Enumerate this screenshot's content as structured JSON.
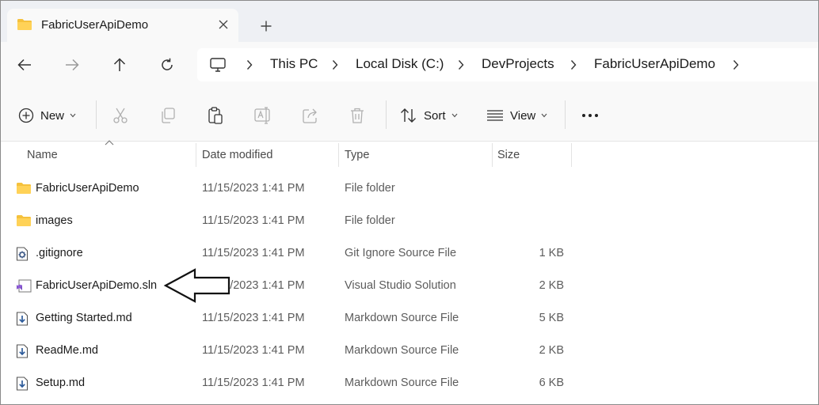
{
  "window": {
    "tab_title": "FabricUserApiDemo",
    "tab_icon": "folder-icon",
    "folder_color": "#f5c13c"
  },
  "breadcrumb": [
    "This PC",
    "Local Disk (C:)",
    "DevProjects",
    "FabricUserApiDemo"
  ],
  "toolbar": {
    "new_label": "New",
    "sort_label": "Sort",
    "view_label": "View",
    "icons": [
      "new-icon",
      "cut-icon",
      "copy-icon",
      "paste-icon",
      "rename-icon",
      "share-icon",
      "delete-icon",
      "sort-icon",
      "view-icon",
      "more-icon"
    ]
  },
  "columns": {
    "name": "Name",
    "date": "Date modified",
    "type": "Type",
    "size": "Size"
  },
  "files": [
    {
      "name": "FabricUserApiDemo",
      "date": "11/15/2023 1:41 PM",
      "type": "File folder",
      "size": "",
      "icon": "folder-icon"
    },
    {
      "name": "images",
      "date": "11/15/2023 1:41 PM",
      "type": "File folder",
      "size": "",
      "icon": "folder-icon"
    },
    {
      "name": ".gitignore",
      "date": "11/15/2023 1:41 PM",
      "type": "Git Ignore Source File",
      "size": "1 KB",
      "icon": "gear-file-icon"
    },
    {
      "name": "FabricUserApiDemo.sln",
      "date": "11/15/2023 1:41 PM",
      "type": "Visual Studio Solution",
      "size": "2 KB",
      "icon": "visual-studio-icon"
    },
    {
      "name": "Getting Started.md",
      "date": "11/15/2023 1:41 PM",
      "type": "Markdown Source File",
      "size": "5 KB",
      "icon": "markdown-file-icon"
    },
    {
      "name": "ReadMe.md",
      "date": "11/15/2023 1:41 PM",
      "type": "Markdown Source File",
      "size": "2 KB",
      "icon": "markdown-file-icon"
    },
    {
      "name": "Setup.md",
      "date": "11/15/2023 1:41 PM",
      "type": "Markdown Source File",
      "size": "6 KB",
      "icon": "markdown-file-icon"
    }
  ],
  "annotation": {
    "icon": "pointer-arrow-icon",
    "points_to": "FabricUserApiDemo.sln"
  }
}
